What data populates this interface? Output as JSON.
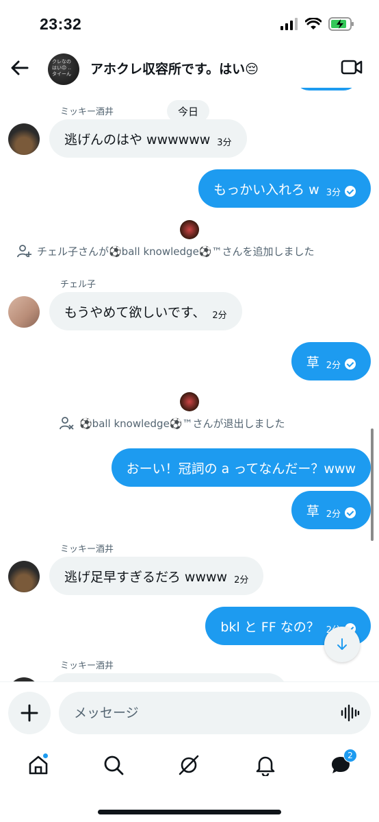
{
  "status_bar": {
    "time": "23:32"
  },
  "header": {
    "title": "アホクレ収容所です。はい😔",
    "avatar_text": "クレなの\nはい😔 ..\nタイーん"
  },
  "thread": {
    "date_separator": "今日",
    "messages": [
      {
        "sender": "ミッキー酒井",
        "text": "逃げんのはや wwwwww",
        "time": "3分"
      },
      {
        "text": "もっかい入れろ w",
        "time": "3分"
      },
      {
        "text": "チェル子さんが⚽ball knowledge⚽™さんを追加しました"
      },
      {
        "sender": "チェル子",
        "text": "もうやめて欲しいです、",
        "time": "2分"
      },
      {
        "text": "草",
        "time": "2分"
      },
      {
        "text": "⚽ball knowledge⚽™さんが退出しました"
      },
      {
        "text": "おーい！冠詞の a ってなんだー？www"
      },
      {
        "text": "草",
        "time": "2分"
      },
      {
        "sender": "ミッキー酒井",
        "text": "逃げ足早すぎるだろ wwww",
        "time": "2分"
      },
      {
        "text": "bkl と FF なの？",
        "time": "2分"
      },
      {
        "sender": "ミッキー酒井"
      }
    ]
  },
  "composer": {
    "placeholder": "メッセージ"
  },
  "tabbar": {
    "messages_badge": "2"
  },
  "colors": {
    "accent": "#1d9bf0",
    "bubble_in": "#eff3f4",
    "muted": "#536471"
  },
  "icons": [
    "back-arrow-icon",
    "video-icon",
    "add-user-icon",
    "user-leave-icon",
    "arrow-down-icon",
    "plus-icon",
    "voice-wave-icon",
    "home-icon",
    "search-icon",
    "grok-icon",
    "bell-icon",
    "messages-icon"
  ]
}
